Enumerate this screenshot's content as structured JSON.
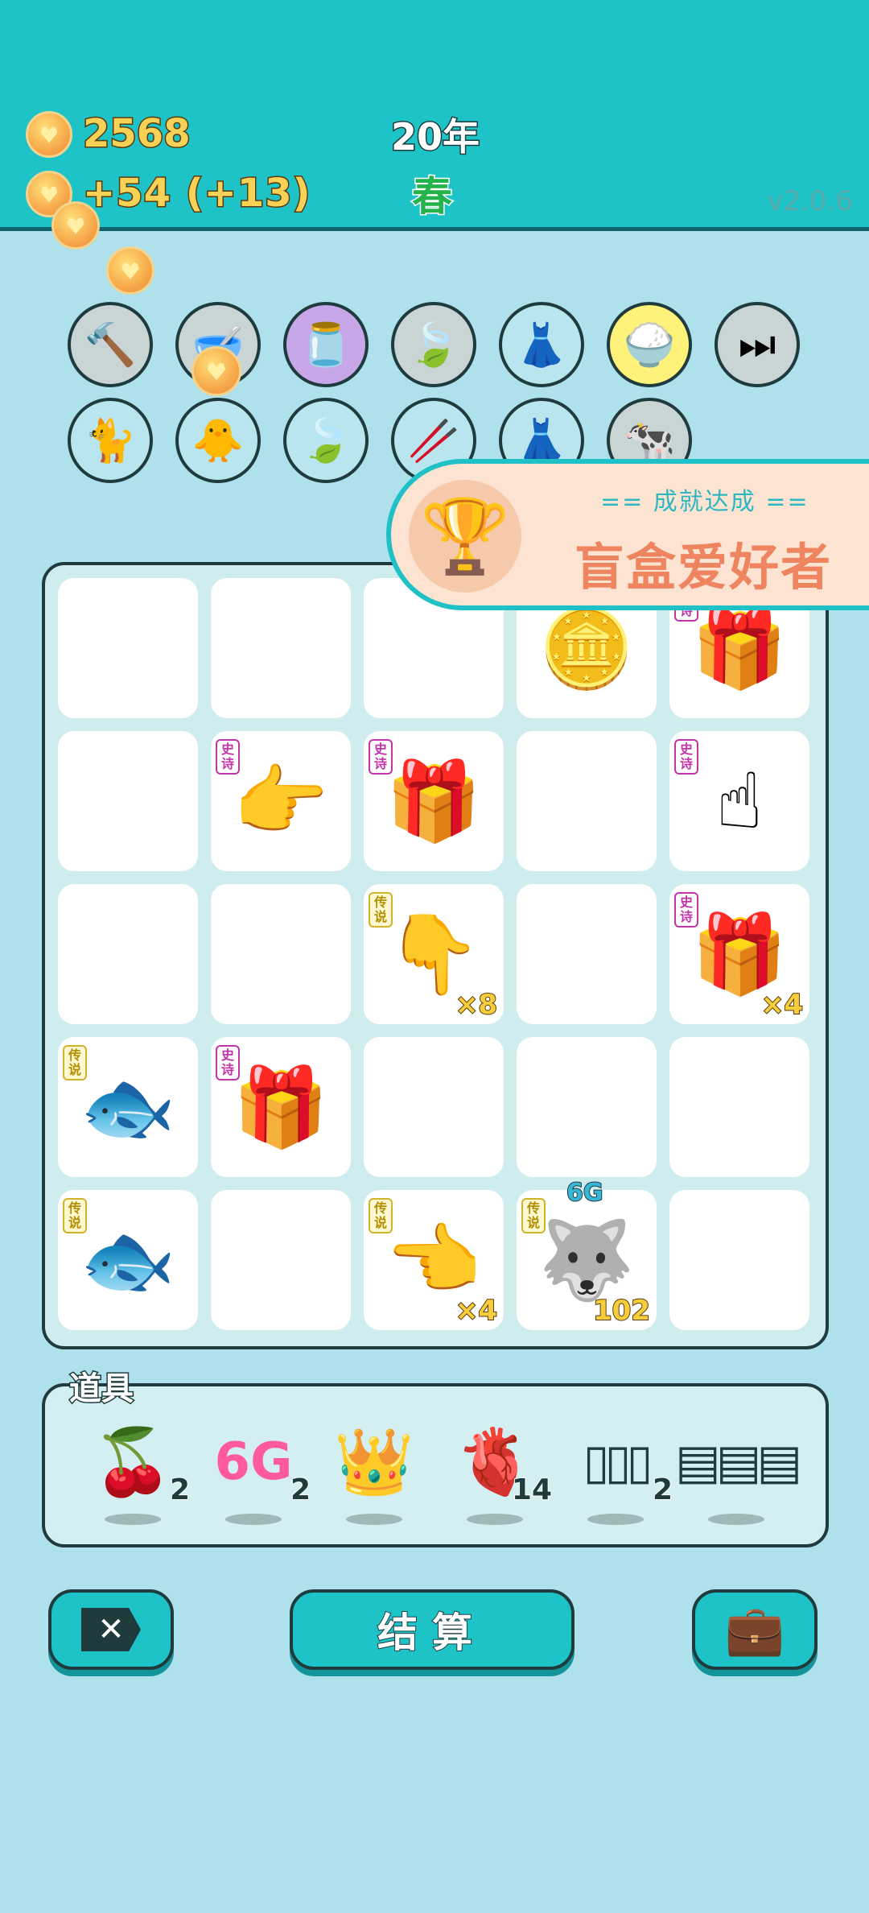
{
  "header": {
    "money": "2568",
    "income": "+54  (+13)",
    "year": "20年",
    "season": "春",
    "version": "v2.0.6"
  },
  "tools": [
    {
      "name": "hammer-icon",
      "glyph": "🔨",
      "bg": "#c9d4d4"
    },
    {
      "name": "mortar-icon",
      "glyph": "🥣",
      "bg": "#c9d4d4"
    },
    {
      "name": "milk-jar-icon",
      "glyph": "🫙",
      "bg": "#c7a7e8"
    },
    {
      "name": "leaf-icon",
      "glyph": "🍃",
      "bg": "#c9d4d4"
    },
    {
      "name": "skirt-icon",
      "glyph": "👗",
      "bg": "#b9e5ee"
    },
    {
      "name": "rice-bowl-icon",
      "glyph": "🍚",
      "bg": "#fff27a"
    },
    {
      "name": "skip-icon",
      "glyph": "⏭",
      "bg": "#c9d4d4"
    },
    {
      "name": "cat-icon",
      "glyph": "🐈",
      "bg": "#b9e5ee"
    },
    {
      "name": "chick-icon",
      "glyph": "🐥",
      "bg": "#b9e5ee"
    },
    {
      "name": "leaf-icon-2",
      "glyph": "🍃",
      "bg": "#b9e5ee"
    },
    {
      "name": "chopsticks-icon",
      "glyph": "🥢",
      "bg": "#b9e5ee"
    },
    {
      "name": "skirt-icon-2",
      "glyph": "👗",
      "bg": "#b9e5ee"
    },
    {
      "name": "cows-icon",
      "glyph": "🐄",
      "bg": "#c9d4d4"
    }
  ],
  "achievement": {
    "subtitle": "== 成就达成 ==",
    "title": "盲盒爱好者"
  },
  "badges": {
    "epic": "史诗",
    "legend": "传说"
  },
  "grid": [
    [
      {},
      {},
      {},
      {
        "item": "coins"
      },
      {
        "item": "blind-box",
        "rarity": "epic"
      }
    ],
    [
      {},
      {
        "item": "hand-point-right",
        "rarity": "epic"
      },
      {
        "item": "blind-box",
        "rarity": "epic"
      },
      {},
      {
        "item": "hand-point-up",
        "rarity": "epic"
      }
    ],
    [
      {},
      {},
      {
        "item": "hand-point-down",
        "rarity": "legend",
        "count": "×8"
      },
      {},
      {
        "item": "blind-box",
        "rarity": "epic",
        "count": "×4"
      }
    ],
    [
      {
        "item": "koi-fish",
        "rarity": "legend"
      },
      {
        "item": "blind-box",
        "rarity": "epic"
      },
      {},
      {},
      {}
    ],
    [
      {
        "item": "koi-fish",
        "rarity": "legend"
      },
      {},
      {
        "item": "hand-point-left",
        "rarity": "legend",
        "count": "×4"
      },
      {
        "item": "husky-king",
        "rarity": "legend",
        "count": "102",
        "tag": "6G"
      },
      {}
    ]
  ],
  "props": {
    "label": "道具",
    "items": [
      {
        "name": "lychee-prop",
        "glyph": "🍒",
        "count": "2"
      },
      {
        "name": "6g-prop",
        "glyph": "6G",
        "count": "2"
      },
      {
        "name": "crown-prop",
        "glyph": "👑",
        "count": ""
      },
      {
        "name": "liver-prop",
        "glyph": "🫀",
        "count": "14"
      },
      {
        "name": "frames-prop",
        "glyph": "▯▯▯",
        "count": "2"
      },
      {
        "name": "cards-prop",
        "glyph": "▤▤▤",
        "count": ""
      }
    ]
  },
  "buttons": {
    "settle": "结算"
  }
}
